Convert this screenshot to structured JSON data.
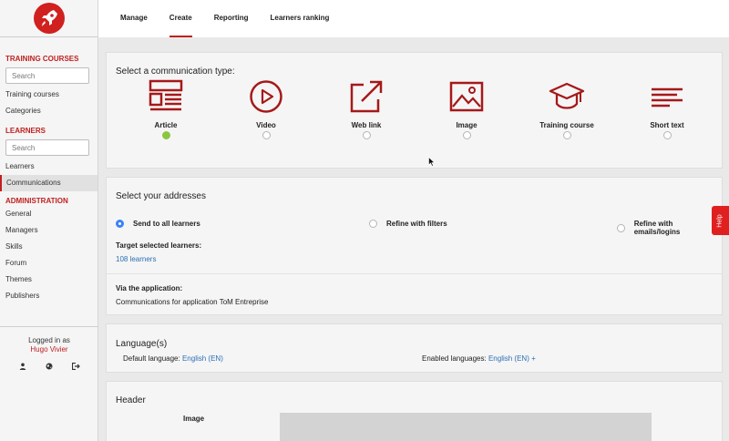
{
  "sidebar": {
    "training_title": "TRAINING COURSES",
    "search1_placeholder": "Search",
    "training_items": [
      "Training courses",
      "Categories"
    ],
    "learners_title": "LEARNERS",
    "search2_placeholder": "Search",
    "learners_items": [
      "Learners",
      "Communications"
    ],
    "admin_title": "ADMINISTRATION",
    "admin_items": [
      "General",
      "Managers",
      "Skills",
      "Forum",
      "Themes",
      "Publishers"
    ],
    "logged_in_as": "Logged in as",
    "user_name": "Hugo Vivier"
  },
  "topnav": {
    "tabs": [
      "Manage",
      "Create",
      "Reporting",
      "Learners ranking"
    ],
    "active": "Create"
  },
  "comm_type": {
    "title": "Select a communication type:",
    "options": [
      "Article",
      "Video",
      "Web link",
      "Image",
      "Training course",
      "Short text"
    ],
    "selected": "Article"
  },
  "addresses": {
    "title": "Select your addresses",
    "options": [
      "Send to all learners",
      "Refine with filters",
      "Refine with emails/logins"
    ],
    "selected": "Send to all learners",
    "target_label": "Target selected learners:",
    "target_value": "108 learners",
    "via_label": "Via the application:",
    "via_value": "Communications for application ToM Entreprise"
  },
  "languages": {
    "title": "Language(s)",
    "default_label": "Default language:",
    "default_value": "English (EN)",
    "enabled_label": "Enabled languages:",
    "enabled_value": "English (EN) +"
  },
  "header_section": {
    "title": "Header",
    "image_label": "Image"
  },
  "help": "Help",
  "colors": {
    "accent": "#c0201f",
    "link": "#2b6fb6",
    "selected_green": "#8cc63f",
    "selected_blue": "#3b82f6"
  }
}
